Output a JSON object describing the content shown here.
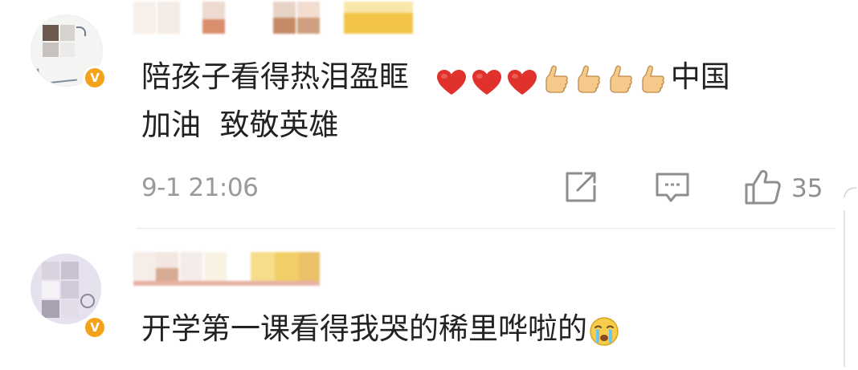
{
  "comments": [
    {
      "text_line1": "陪孩子看得热泪盈眶",
      "thumbs_up_tail": "中国",
      "text_line2": "加油  致敬英雄",
      "hearts": 3,
      "thumbs_up": 4,
      "timestamp": "9-1 21:06",
      "like_count": "35",
      "verified": true
    },
    {
      "text": "开学第一课看得我哭的稀里哗啦的",
      "verified": true
    }
  ],
  "icons": {
    "share": "share-icon",
    "comment": "comment-icon",
    "like": "thumbs-up-icon",
    "badge": "verified-v-icon",
    "heart": "red-heart-emoji",
    "thumb": "thumbs-up-emoji",
    "cry": "crying-face-emoji"
  },
  "badge_letter": "V",
  "colors": {
    "badge": "#f4a21a",
    "heart": "#e0312c",
    "meta_text": "#9a9a9a",
    "body_text": "#222222"
  }
}
